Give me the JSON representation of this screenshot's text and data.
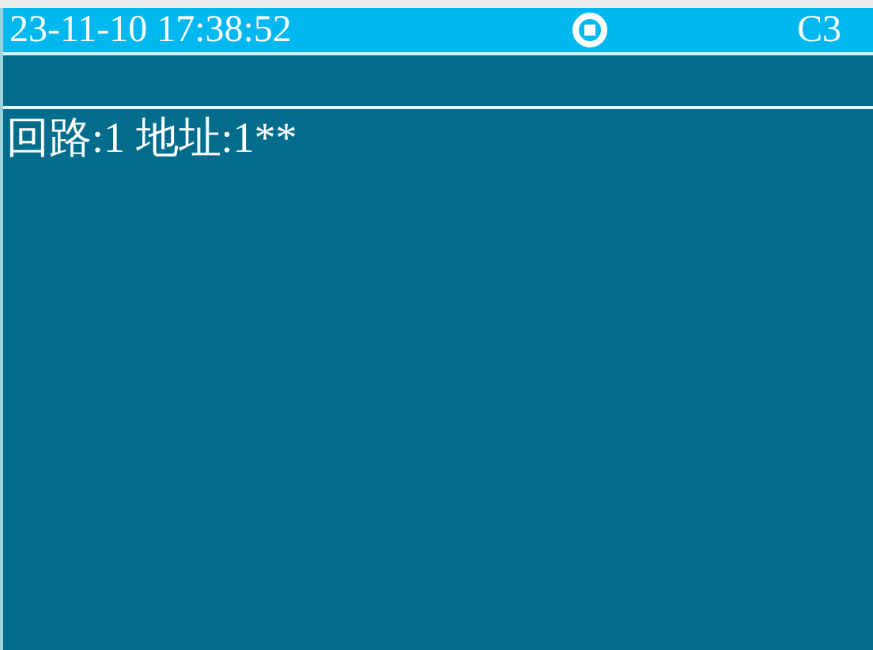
{
  "status_bar": {
    "datetime": "23-11-10 17:38:52",
    "channel": "C3"
  },
  "address_line": "回路:1 地址:1**"
}
